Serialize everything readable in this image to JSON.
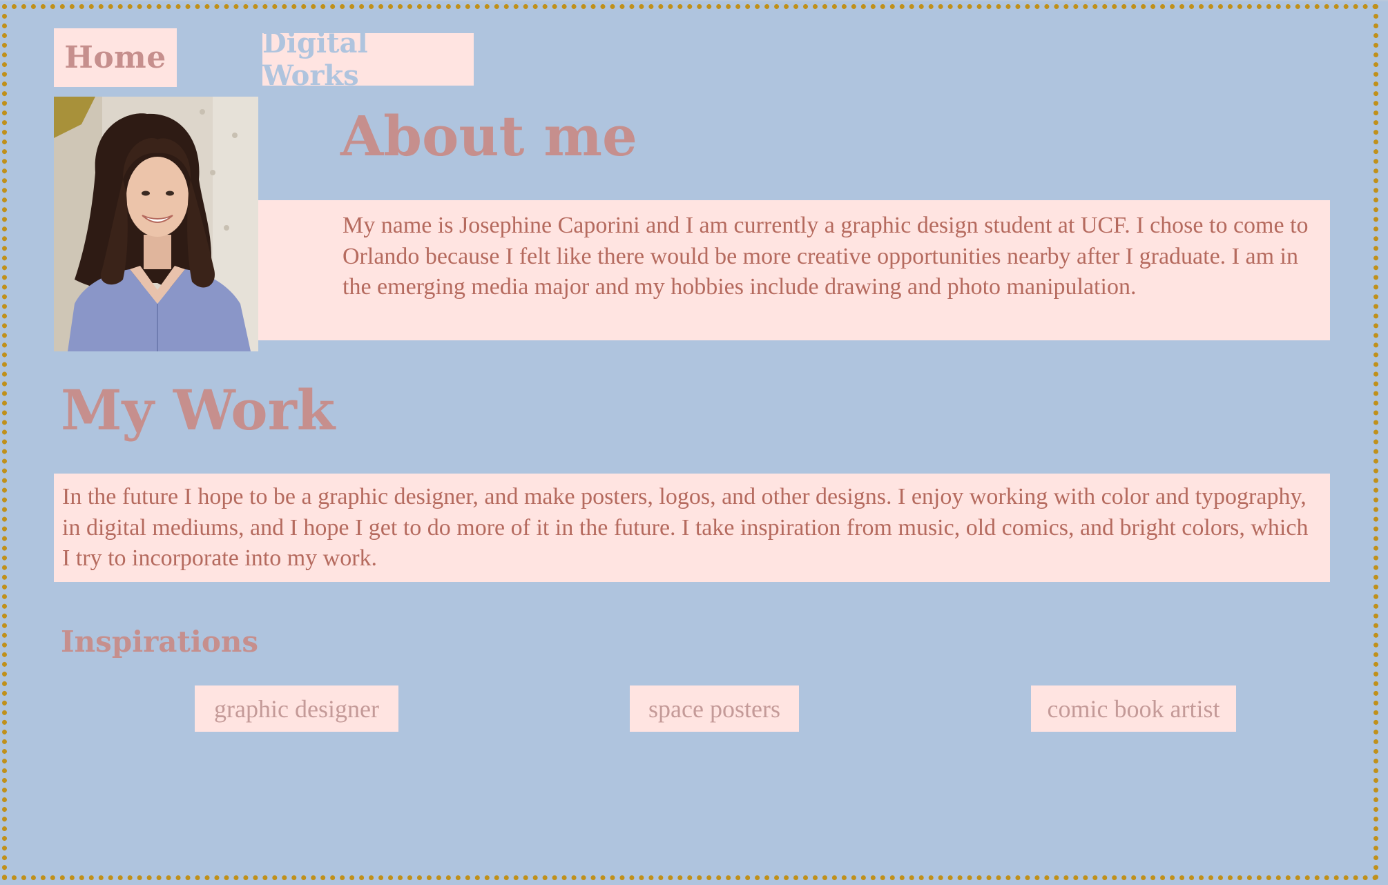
{
  "nav": {
    "home_label": "Home",
    "digital_works_label": "Digital Works"
  },
  "about": {
    "heading": "About me",
    "body": "My name is Josephine Caporini and I am currently a graphic design student at UCF. I chose to come to Orlando because I felt like there would be more creative opportunities nearby after I graduate. I am in the emerging media major and my hobbies include drawing and photo manipulation."
  },
  "work": {
    "heading": "My Work",
    "body": "In the future I hope to be a graphic designer, and make posters, logos, and other designs. I enjoy working with color and typography, in digital mediums, and I hope I get to do more of it in the future. I take inspiration from music, old comics, and bright colors, which I try to incorporate into my work."
  },
  "inspirations": {
    "heading": "Inspirations",
    "links": [
      {
        "label": "graphic designer"
      },
      {
        "label": "space posters"
      },
      {
        "label": "comic book artist"
      }
    ]
  },
  "colors": {
    "page_background": "#afc4de",
    "box_background": "#ffe4e1",
    "heading": "#c68f8d",
    "body_text": "#b56a5e",
    "border_dots": "#c0901a"
  }
}
